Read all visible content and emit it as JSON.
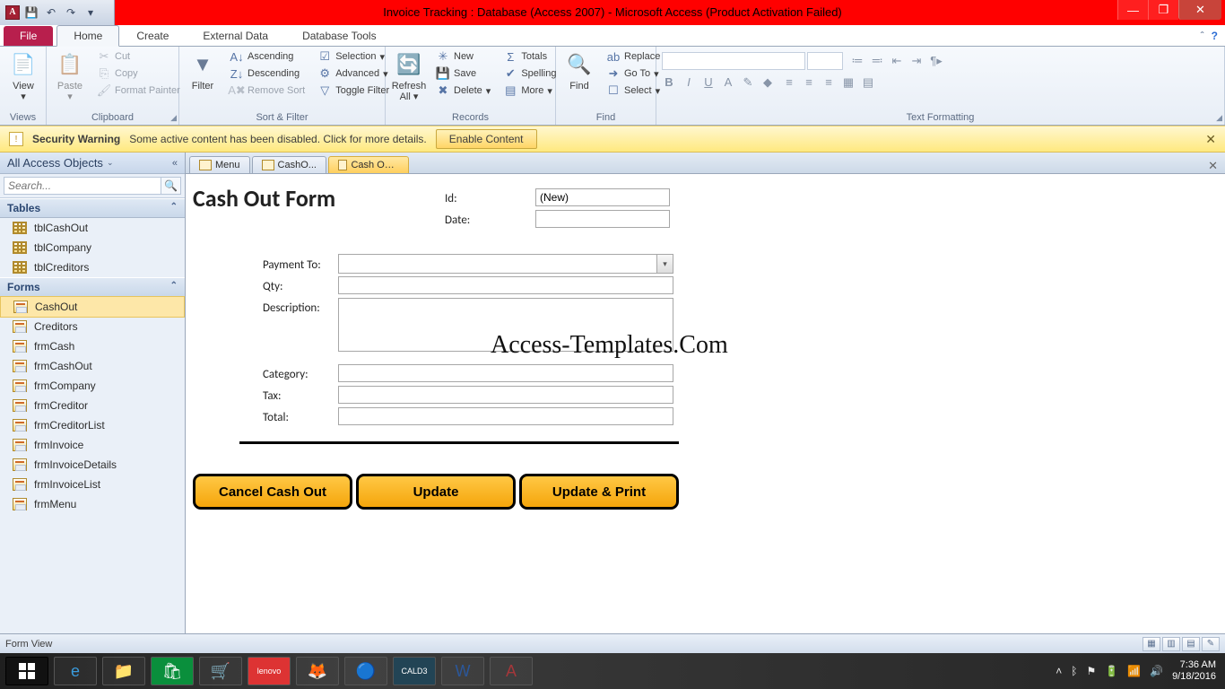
{
  "title": "Invoice Tracking : Database (Access 2007) - Microsoft Access (Product Activation Failed)",
  "menu": {
    "file": "File",
    "home": "Home",
    "create": "Create",
    "external": "External Data",
    "tools": "Database Tools"
  },
  "ribbon": {
    "views": {
      "view": "View",
      "group": "Views"
    },
    "clipboard": {
      "paste": "Paste",
      "cut": "Cut",
      "copy": "Copy",
      "painter": "Format Painter",
      "group": "Clipboard"
    },
    "sort": {
      "filter": "Filter",
      "asc": "Ascending",
      "desc": "Descending",
      "remove": "Remove Sort",
      "sel": "Selection",
      "adv": "Advanced",
      "tog": "Toggle Filter",
      "group": "Sort & Filter"
    },
    "records": {
      "refresh": "Refresh\nAll",
      "new": "New",
      "save": "Save",
      "delete": "Delete",
      "totals": "Totals",
      "spelling": "Spelling",
      "more": "More",
      "group": "Records"
    },
    "find": {
      "find": "Find",
      "replace": "Replace",
      "goto": "Go To",
      "select": "Select",
      "group": "Find"
    },
    "text": {
      "group": "Text Formatting"
    }
  },
  "security": {
    "title": "Security Warning",
    "msg": "Some active content has been disabled. Click for more details.",
    "enable": "Enable Content"
  },
  "nav": {
    "header": "All Access Objects",
    "search_ph": "Search...",
    "tables_h": "Tables",
    "tables": [
      "tblCashOut",
      "tblCompany",
      "tblCreditors"
    ],
    "forms_h": "Forms",
    "forms": [
      "CashOut",
      "Creditors",
      "frmCash",
      "frmCashOut",
      "frmCompany",
      "frmCreditor",
      "frmCreditorList",
      "frmInvoice",
      "frmInvoiceDetails",
      "frmInvoiceList",
      "frmMenu"
    ]
  },
  "tabs": [
    "Menu",
    "CashO...",
    "Cash Out Form"
  ],
  "form": {
    "title": "Cash Out Form",
    "id_l": "Id:",
    "id_v": "(New)",
    "date_l": "Date:",
    "payto_l": "Payment To:",
    "qty_l": "Qty:",
    "desc_l": "Description:",
    "cat_l": "Category:",
    "tax_l": "Tax:",
    "total_l": "Total:",
    "btn_cancel": "Cancel Cash Out",
    "btn_update": "Update",
    "btn_print": "Update & Print",
    "watermark": "Access-Templates.Com"
  },
  "status": {
    "view": "Form View"
  },
  "clock": {
    "time": "7:36 AM",
    "date": "9/18/2016"
  }
}
